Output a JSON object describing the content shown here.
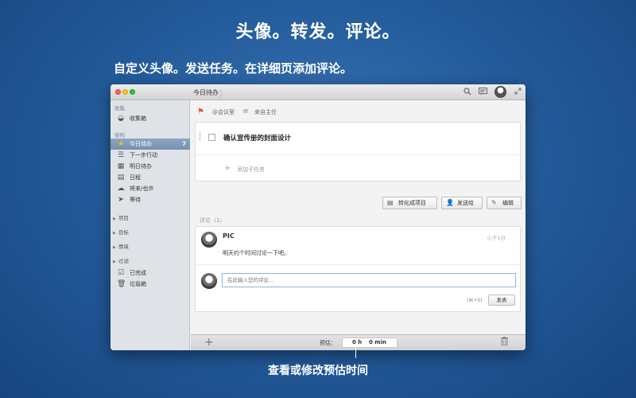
{
  "promo": {
    "headline": "头像。转发。评论。",
    "subline": "自定义头像。发送任务。在详细页添加评论。",
    "caption": "查看或修改预估时间"
  },
  "titlebar": {
    "title": "今日待办",
    "breadcrumb_chevron": "〉",
    "icons": [
      "search-icon",
      "chat-icon",
      "avatar",
      "fullscreen-icon"
    ]
  },
  "sidebar": {
    "section_inbox": "收集",
    "inbox_item": {
      "label": "收集箱",
      "icon": "inbox-icon"
    },
    "section_shelf": "架构",
    "items": [
      {
        "label": "今日待办",
        "icon": "star-icon",
        "count": "7",
        "active": true
      },
      {
        "label": "下一步行动",
        "icon": "list-icon"
      },
      {
        "label": "明日待办",
        "icon": "calendar-icon"
      },
      {
        "label": "日程",
        "icon": "schedule-icon"
      },
      {
        "label": "将来/也许",
        "icon": "cloud-icon"
      },
      {
        "label": "等待",
        "icon": "send-icon"
      }
    ],
    "groups": [
      "项目",
      "目标",
      "情境",
      "过滤"
    ],
    "bottom_items": [
      {
        "label": "已完成",
        "icon": "check-box-icon"
      },
      {
        "label": "垃圾箱",
        "icon": "trash-icon"
      }
    ]
  },
  "task": {
    "context": "@会议室",
    "source": "来自主任",
    "title": "确认宣传册的封面设计",
    "add_subtask": "添加子任务"
  },
  "actions": {
    "convert": "转化成项目",
    "send": "发送给",
    "edit": "编辑"
  },
  "comments": {
    "header": "评论（1）",
    "items": [
      {
        "author": "PIC",
        "time": "小于1分",
        "text": "明天约个时间讨论一下吧。"
      }
    ],
    "input_placeholder": "在此输入您的评论...",
    "shortcut_hint": "(⌘+S)",
    "send_label": "发表"
  },
  "bottombar": {
    "estimate_label": "预估：",
    "hours": "0 h",
    "minutes": "0 min"
  }
}
